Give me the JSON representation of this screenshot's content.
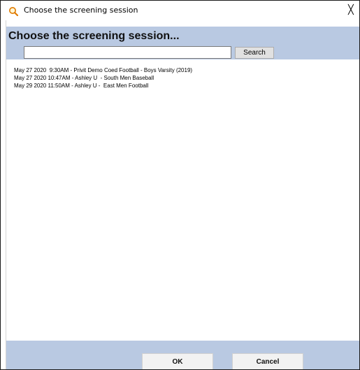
{
  "window": {
    "title": "Choose the screening session",
    "title_icon": "magnifier-icon",
    "close_glyph": "╳"
  },
  "header": {
    "title": "Choose the screening session..."
  },
  "search": {
    "value": "",
    "button_label": "Search"
  },
  "sessions": [
    "May 27 2020  9:30AM - Privit Demo Coed Football - Boys Varsity (2019)",
    "May 27 2020 10:47AM - Ashley U  - South Men Baseball",
    "May 29 2020 11:50AM - Ashley U -  East Men Football"
  ],
  "footer": {
    "ok_label": "OK",
    "cancel_label": "Cancel"
  },
  "colors": {
    "band": "#b9c9e2",
    "button_face": "#e1e1e1",
    "icon_orange": "#e07b00"
  }
}
